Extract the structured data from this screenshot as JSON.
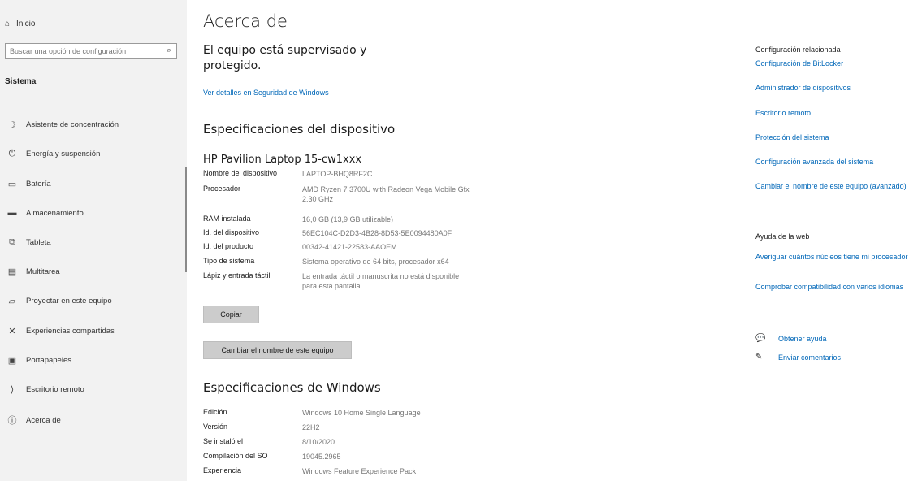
{
  "sidebar": {
    "home_label": "Inicio",
    "search_placeholder": "Buscar una opción de configuración",
    "section_title": "Sistema",
    "items": [
      {
        "label": "Asistente de concentración",
        "icon": "moon-icon"
      },
      {
        "label": "Energía y suspensión",
        "icon": "power-icon"
      },
      {
        "label": "Batería",
        "icon": "battery-icon"
      },
      {
        "label": "Almacenamiento",
        "icon": "storage-icon"
      },
      {
        "label": "Tableta",
        "icon": "tablet-icon"
      },
      {
        "label": "Multitarea",
        "icon": "multitask-icon"
      },
      {
        "label": "Proyectar en este equipo",
        "icon": "project-icon"
      },
      {
        "label": "Experiencias compartidas",
        "icon": "shared-icon"
      },
      {
        "label": "Portapapeles",
        "icon": "clipboard-icon"
      },
      {
        "label": "Escritorio remoto",
        "icon": "remote-icon"
      },
      {
        "label": "Acerca de",
        "icon": "info-icon"
      }
    ]
  },
  "main": {
    "title": "Acerca de",
    "protection_text": "El equipo está supervisado y protegido.",
    "security_link": "Ver detalles en Seguridad de Windows",
    "device_section": "Especificaciones del dispositivo",
    "model": "HP Pavilion Laptop 15-cw1xxx",
    "device_specs": [
      {
        "key": "Nombre del dispositivo",
        "value": "LAPTOP-BHQ8RF2C"
      },
      {
        "key": "Procesador",
        "value": "AMD Ryzen 7 3700U with Radeon Vega Mobile Gfx     2.30 GHz"
      },
      {
        "key": "RAM instalada",
        "value": "16,0 GB (13,9 GB utilizable)"
      },
      {
        "key": "Id. del dispositivo",
        "value": "56EC104C-D2D3-4B28-8D53-5E0094480A0F"
      },
      {
        "key": "Id. del producto",
        "value": "00342-41421-22583-AAOEM"
      },
      {
        "key": "Tipo de sistema",
        "value": "Sistema operativo de 64 bits, procesador x64"
      },
      {
        "key": "Lápiz y entrada táctil",
        "value": "La entrada táctil o manuscrita no está disponible para esta pantalla"
      }
    ],
    "copy_button": "Copiar",
    "rename_button": "Cambiar el nombre de este equipo",
    "windows_section": "Especificaciones de Windows",
    "windows_specs": [
      {
        "key": "Edición",
        "value": "Windows 10 Home Single Language"
      },
      {
        "key": "Versión",
        "value": "22H2"
      },
      {
        "key": "Se instaló el",
        "value": "8/10/2020"
      },
      {
        "key": "Compilación del SO",
        "value": "19045.2965"
      },
      {
        "key": "Experiencia",
        "value": "Windows Feature Experience Pack"
      }
    ]
  },
  "right": {
    "related_title": "Configuración relacionada",
    "related_links": [
      "Configuración de BitLocker",
      "Administrador de dispositivos",
      "Escritorio remoto",
      "Protección del sistema",
      "Configuración avanzada del sistema",
      "Cambiar el nombre de este equipo (avanzado)"
    ],
    "web_help_title": "Ayuda de la web",
    "web_links": [
      "Averiguar cuántos núcleos tiene mi procesador",
      "Comprobar compatibilidad con varios idiomas"
    ],
    "get_help": "Obtener ayuda",
    "feedback": "Enviar comentarios"
  }
}
